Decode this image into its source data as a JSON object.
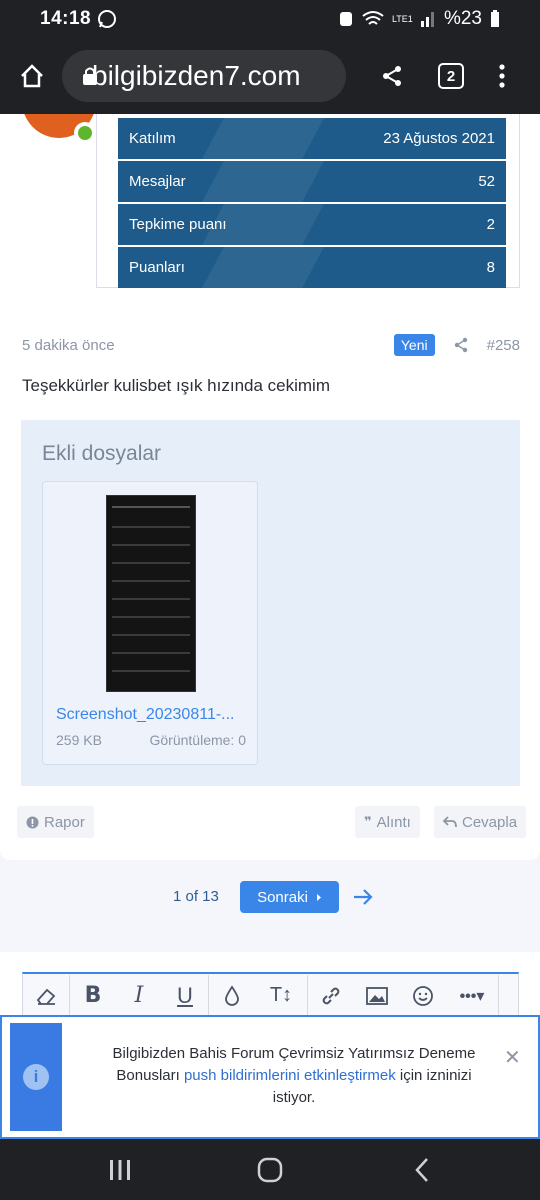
{
  "status": {
    "time": "14:18",
    "battery": "%23",
    "network": "LTE1"
  },
  "browser": {
    "url": "bilgibizden7.com",
    "tab_count": "2"
  },
  "stats": [
    {
      "label": "Katılım",
      "value": "23 Ağustos 2021"
    },
    {
      "label": "Mesajlar",
      "value": "52"
    },
    {
      "label": "Tepkime puanı",
      "value": "2"
    },
    {
      "label": "Puanları",
      "value": "8"
    }
  ],
  "post": {
    "time": "5 dakika önce",
    "badge": "Yeni",
    "number": "#258",
    "text": "Teşekkürler kulisbet ışık hızında cekimim"
  },
  "attachments": {
    "title": "Ekli dosyalar",
    "file_name": "Screenshot_20230811-...",
    "file_size": "259 KB",
    "views": "Görüntüleme: 0"
  },
  "actions": {
    "report": "Rapor",
    "quote": "Alıntı",
    "reply": "Cevapla"
  },
  "pagination": {
    "count": "1 of 13",
    "next": "Sonraki"
  },
  "notification": {
    "text_before": "Bilgibizden Bahis Forum Çevrimsiz Yatırımsız Deneme Bonusları ",
    "link": "push bildirimlerini etkinleştirmek",
    "text_after": " için izninizi istiyor."
  }
}
